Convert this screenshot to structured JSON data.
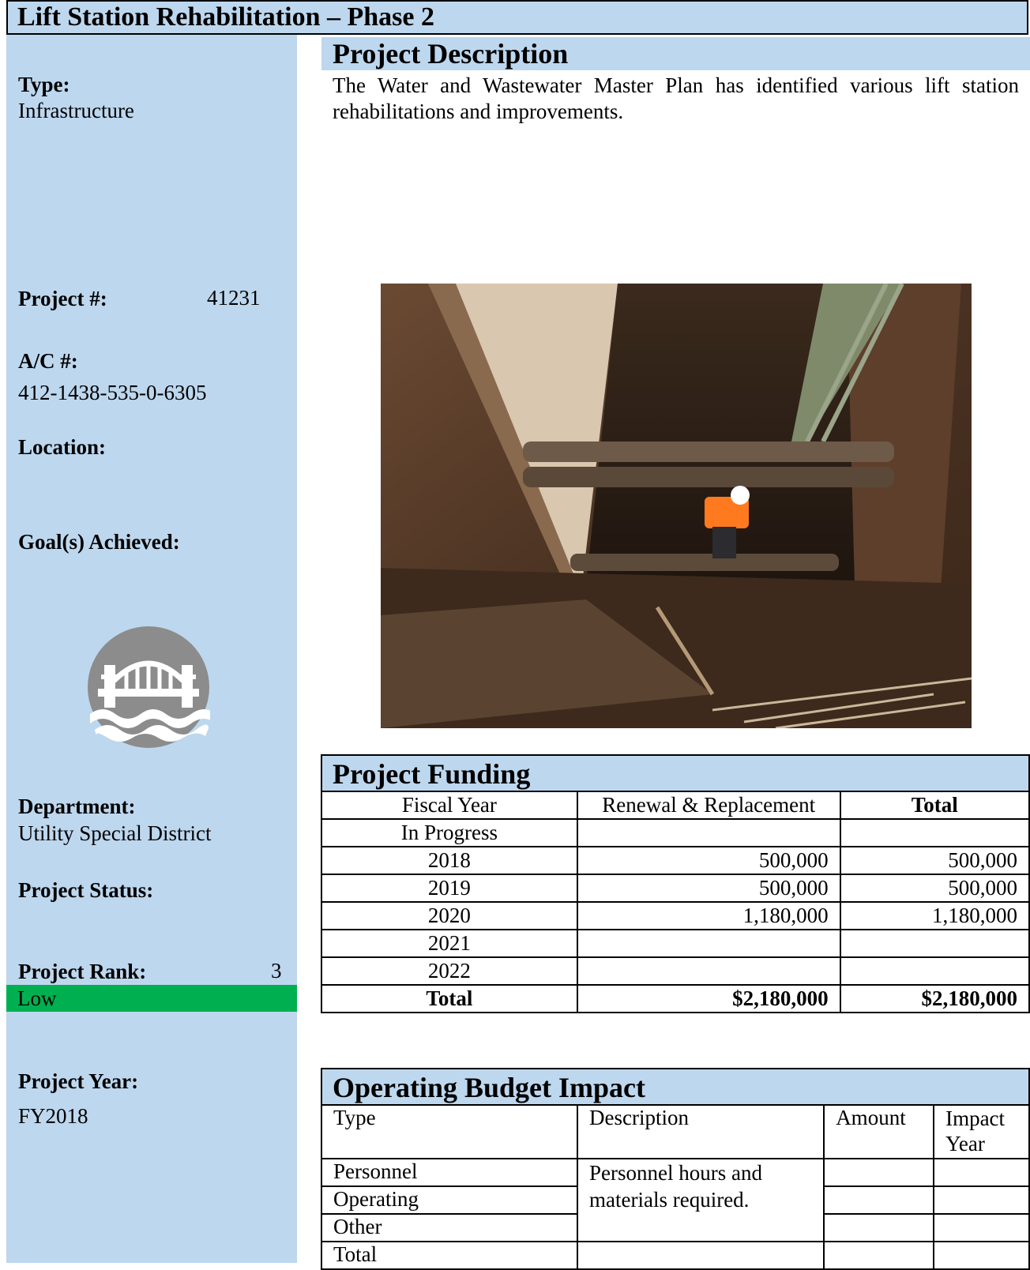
{
  "title": "Lift Station Rehabilitation – Phase 2",
  "sidebar": {
    "type_label": "Type:",
    "type_value": "Infrastructure",
    "project_no_label": "Project #:",
    "project_no_value": "41231",
    "ac_label": "A/C #:",
    "ac_value": "412-1438-535-0-6305",
    "location_label": "Location:",
    "goals_label": "Goal(s) Achieved:",
    "goal_icon": "bridge-over-water-icon",
    "department_label": "Department:",
    "department_value": "Utility Special District",
    "status_label": "Project Status:",
    "rank_label": "Project Rank:",
    "rank_value": "3",
    "rank_level": "Low",
    "rank_color": "#00b050",
    "year_label": "Project Year:",
    "year_value": "FY2018"
  },
  "description": {
    "heading": "Project Description",
    "text": "The Water and Wastewater Master Plan has identified various lift station rehabilitations and improvements."
  },
  "funding": {
    "heading": "Project Funding",
    "columns": [
      "Fiscal Year",
      "Renewal & Replacement",
      "Total"
    ],
    "rows": [
      [
        "In Progress",
        "",
        ""
      ],
      [
        "2018",
        "500,000",
        "500,000"
      ],
      [
        "2019",
        "500,000",
        "500,000"
      ],
      [
        "2020",
        "1,180,000",
        "1,180,000"
      ],
      [
        "2021",
        "",
        ""
      ],
      [
        "2022",
        "",
        ""
      ]
    ],
    "total_row": [
      "Total",
      "$2,180,000",
      "$2,180,000"
    ]
  },
  "operating": {
    "heading": "Operating Budget Impact",
    "columns": [
      "Type",
      "Description",
      "Amount",
      "Impact Year"
    ],
    "types": [
      "Personnel",
      "Operating",
      "Other",
      "Total"
    ],
    "description": "Personnel hours and materials required."
  },
  "colors": {
    "header_blue": "#bdd7ee",
    "rank_green": "#00b050"
  }
}
